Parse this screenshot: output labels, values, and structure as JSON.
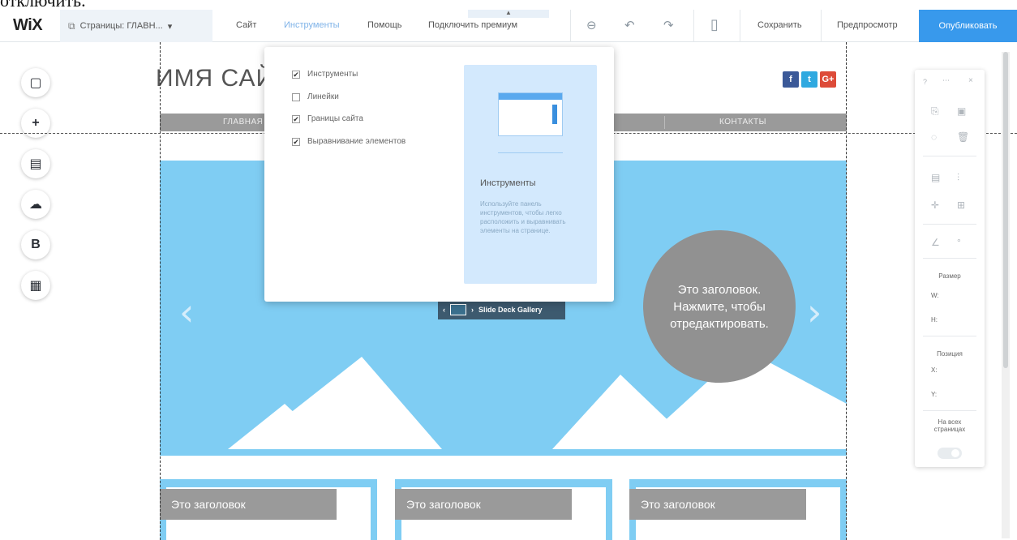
{
  "caption_cut": "отключить.",
  "topbar": {
    "logo": "WiX",
    "pages_dropdown": "Страницы: ГЛАВН...",
    "pages_caret": "▾",
    "nav": [
      "Сайт",
      "Инструменты",
      "Помощь",
      "Подключить премиум"
    ],
    "tab_hint": "▲",
    "save": "Сохранить",
    "preview": "Предпросмотр",
    "publish": "Опубликовать",
    "accent": "#3899ec"
  },
  "site": {
    "name": "ИМЯ САЙ",
    "menu_home": "ГЛАВНАЯ",
    "menu_contacts": "КОНТАКТЫ",
    "social": [
      "f",
      "t",
      "G+"
    ],
    "gallery_tag": "Slide Deck Gallery",
    "circle_text": "Это заголовок. Нажмите, чтобы отредактировать.",
    "box_headings": [
      "Это заголовок",
      "Это заголовок",
      "Это заголовок"
    ]
  },
  "dropdown": {
    "items": [
      {
        "label": "Инструменты",
        "checked": true
      },
      {
        "label": "Линейки",
        "checked": false
      },
      {
        "label": "Границы сайта",
        "checked": true
      },
      {
        "label": "Выравнивание элементов",
        "checked": true
      }
    ],
    "panel_title": "Инструменты",
    "panel_desc": "Используйте панель инструментов, чтобы легко расположить и выравнивать элементы на странице."
  },
  "right_panel": {
    "header": [
      "?",
      "⋯",
      "×"
    ],
    "size_label": "Размер",
    "w": "W:",
    "h": "H:",
    "position_label": "Позиция",
    "x": "X:",
    "y": "Y:",
    "all_pages": "На всех страницах"
  }
}
